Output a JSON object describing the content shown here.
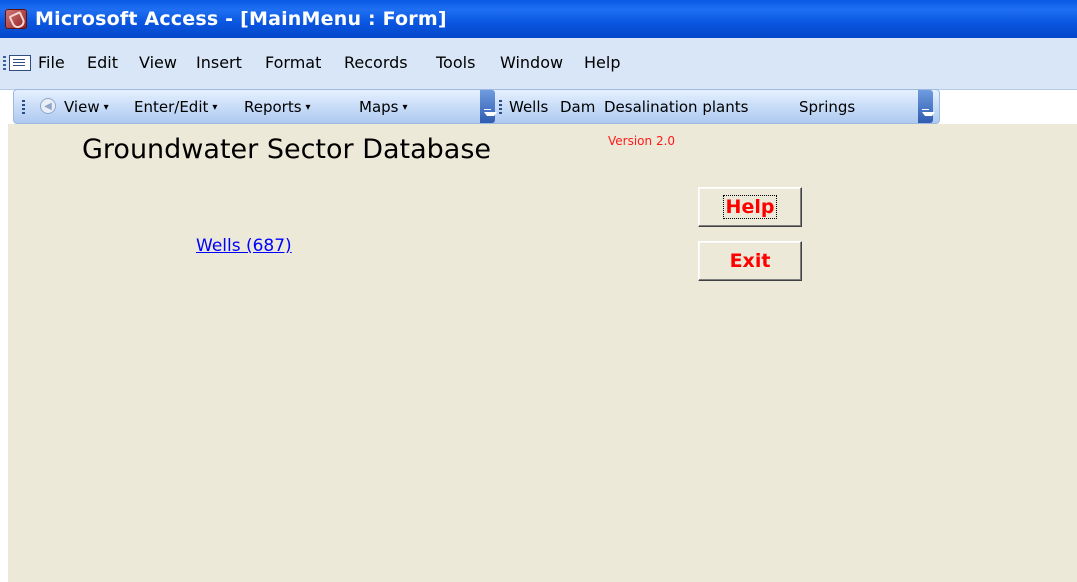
{
  "window": {
    "title": "Microsoft Access - [MainMenu : Form]",
    "title_icon": "access-key-icon"
  },
  "menubar": {
    "items": [
      {
        "label": "File"
      },
      {
        "label": "Edit"
      },
      {
        "label": "View"
      },
      {
        "label": "Insert"
      },
      {
        "label": "Format"
      },
      {
        "label": "Records"
      },
      {
        "label": "Tools"
      },
      {
        "label": "Window"
      },
      {
        "label": "Help"
      }
    ]
  },
  "toolbar": {
    "group1": [
      {
        "label": "View"
      },
      {
        "label": "Enter/Edit"
      },
      {
        "label": "Reports"
      },
      {
        "label": "Maps"
      }
    ],
    "dropdown_caret": "▾",
    "group2": [
      {
        "label": "Wells"
      },
      {
        "label": "Dam"
      },
      {
        "label": "Desalination plants"
      },
      {
        "label": "Springs"
      }
    ]
  },
  "form": {
    "title": "Groundwater Sector Database",
    "version": "Version 2.0",
    "wells_link": "Wells (687)",
    "help_button": "Help",
    "exit_button": "Exit"
  },
  "colors": {
    "titlebar": "#0a58e4",
    "menubar": "#d8e6f8",
    "form_background": "#ece9d8",
    "button_text": "#ff0000",
    "version_text": "#ff1a1a",
    "link": "#0000ff"
  }
}
